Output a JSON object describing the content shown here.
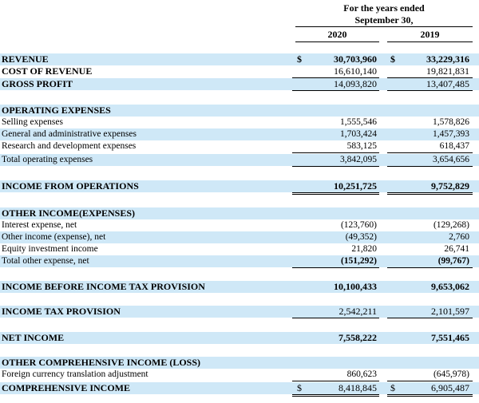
{
  "header": {
    "period_line1": "For the years ended",
    "period_line2": "September 30,",
    "year1": "2020",
    "year2": "2019"
  },
  "rows": {
    "revenue": {
      "label": "REVENUE",
      "cur1": "$",
      "v1": "30,703,960",
      "cur2": "$",
      "v2": "33,229,316"
    },
    "cost_of_revenue": {
      "label": "COST OF REVENUE",
      "v1": "16,610,140",
      "v2": "19,821,831"
    },
    "gross_profit": {
      "label": "GROSS PROFIT",
      "v1": "14,093,820",
      "v2": "13,407,485"
    },
    "operating_expenses": {
      "label": "OPERATING EXPENSES"
    },
    "selling": {
      "label": "Selling expenses",
      "v1": "1,555,546",
      "v2": "1,578,826"
    },
    "general_admin": {
      "label": "General and administrative expenses",
      "v1": "1,703,424",
      "v2": "1,457,393"
    },
    "research": {
      "label": "Research and development expenses",
      "v1": "583,125",
      "v2": "618,437"
    },
    "total_operating": {
      "label": "Total operating expenses",
      "v1": "3,842,095",
      "v2": "3,654,656"
    },
    "income_from_operations": {
      "label": "INCOME FROM OPERATIONS",
      "v1": "10,251,725",
      "v2": "9,752,829"
    },
    "other_income_header": {
      "label": "OTHER INCOME(EXPENSES)"
    },
    "interest": {
      "label": "Interest expense, net",
      "v1": "(123,760)",
      "v2": "(129,268)"
    },
    "other_income": {
      "label": "Other income (expense), net",
      "v1": "(49,352)",
      "v2": "2,760"
    },
    "equity_investment": {
      "label": "Equity investment income",
      "v1": "21,820",
      "v2": "26,741"
    },
    "total_other": {
      "label": "Total other expense, net",
      "v1": "(151,292)",
      "v2": "(99,767)"
    },
    "income_before_tax": {
      "label": "INCOME BEFORE INCOME TAX PROVISION",
      "v1": "10,100,433",
      "v2": "9,653,062"
    },
    "income_tax": {
      "label": "INCOME TAX PROVISION",
      "v1": "2,542,211",
      "v2": "2,101,597"
    },
    "net_income": {
      "label": "NET INCOME",
      "v1": "7,558,222",
      "v2": "7,551,465"
    },
    "oci_header": {
      "label": "OTHER COMPREHENSIVE INCOME (LOSS)"
    },
    "fx_translation": {
      "label": "Foreign currency translation adjustment",
      "v1": "860,623",
      "v2": "(645,978)"
    },
    "comprehensive_income": {
      "label": "COMPREHENSIVE INCOME",
      "cur1": "$",
      "v1": "8,418,845",
      "cur2": "$",
      "v2": "6,905,487"
    }
  },
  "colors": {
    "row_shade": "#cfe8f7",
    "text": "#000000"
  }
}
